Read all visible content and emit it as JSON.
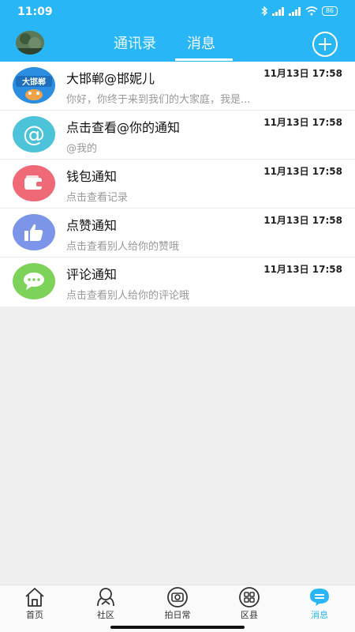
{
  "status": {
    "time": "11:09",
    "battery": "86"
  },
  "nav": {
    "tabs": [
      "通讯录",
      "消息"
    ],
    "active": "消息"
  },
  "messages": [
    {
      "name": "大邯郸@邯妮儿",
      "preview": "你好，你终于来到我们的大家庭，我是...",
      "time": "11月13日 17:58",
      "avatar_text": "大邯郸"
    },
    {
      "name": "点击查看@你的通知",
      "preview": "@我的",
      "time": "11月13日 17:58",
      "icon": "at-icon",
      "color": "#4cc3d9"
    },
    {
      "name": "钱包通知",
      "preview": "点击查看记录",
      "time": "11月13日 17:58",
      "icon": "wallet-icon",
      "color": "#f06977"
    },
    {
      "name": "点赞通知",
      "preview": "点击查看别人给你的赞哦",
      "time": "11月13日 17:58",
      "icon": "thumbs-up-icon",
      "color": "#7c95e8"
    },
    {
      "name": "评论通知",
      "preview": "点击查看别人给你的评论哦",
      "time": "11月13日 17:58",
      "icon": "comment-icon",
      "color": "#7dd35a"
    }
  ],
  "tabbar": [
    {
      "label": "首页",
      "icon": "home-icon"
    },
    {
      "label": "社区",
      "icon": "community-icon"
    },
    {
      "label": "拍日常",
      "icon": "camera-icon"
    },
    {
      "label": "区县",
      "icon": "district-icon"
    },
    {
      "label": "消息",
      "icon": "message-icon",
      "active": true
    }
  ],
  "colors": {
    "accent": "#29b6f6"
  }
}
